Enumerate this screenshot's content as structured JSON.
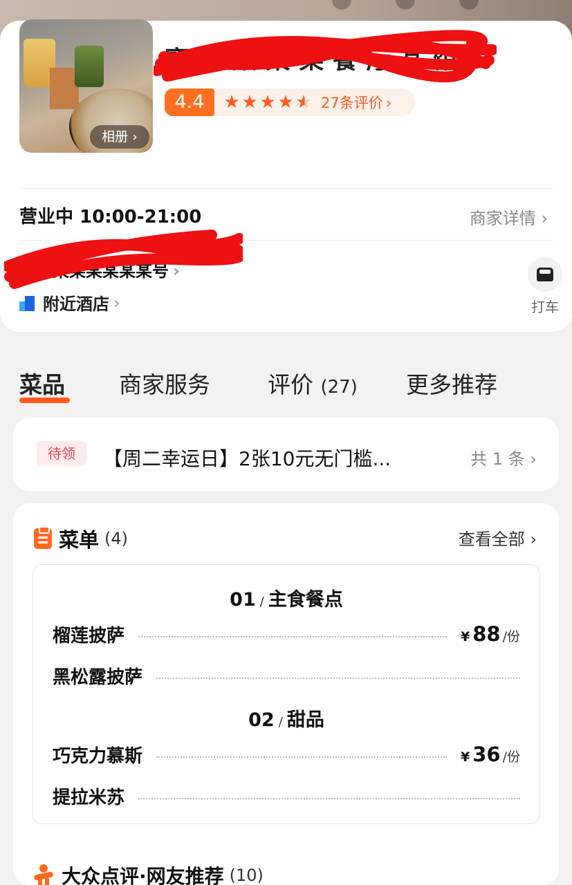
{
  "store": {
    "name": "寶 某 某 某 某 餐 厅 某 馆 店铺",
    "album_label": "相册",
    "rating": "4.4",
    "stars": 4.5,
    "review_summary": "27条评价",
    "hours": "营业中 10:00-21:00",
    "details_link": "商家详情",
    "address": "某某某某某某某某号",
    "nearby_hotels": "附近酒店",
    "taxi_label": "打车"
  },
  "tabs": [
    {
      "label": "菜品",
      "count": ""
    },
    {
      "label": "商家服务",
      "count": ""
    },
    {
      "label": "评价",
      "count": "(27)"
    },
    {
      "label": "更多推荐",
      "count": ""
    }
  ],
  "coupon": {
    "tag": "待领",
    "text": "【周二幸运日】2张10元无门槛...",
    "total": "共 1 条"
  },
  "menu": {
    "title": "菜单",
    "count": "(4)",
    "view_all": "查看全部",
    "sections": [
      {
        "no": "01",
        "name": "主食餐点"
      },
      {
        "no": "02",
        "name": "甜品"
      }
    ],
    "dishes": [
      {
        "name": "榴莲披萨",
        "yen": "¥",
        "price": "88",
        "unit": "/份"
      },
      {
        "name": "黑松露披萨",
        "yen": "",
        "price": "",
        "unit": ""
      },
      {
        "name": "巧克力慕斯",
        "yen": "¥",
        "price": "36",
        "unit": "/份"
      },
      {
        "name": "提拉米苏",
        "yen": "",
        "price": "",
        "unit": ""
      }
    ]
  },
  "recommend": {
    "title": "大众点评·网友推荐",
    "count": "(10)"
  },
  "colors": {
    "accent": "#ff5a1f",
    "coupon_red": "#e8464e"
  }
}
